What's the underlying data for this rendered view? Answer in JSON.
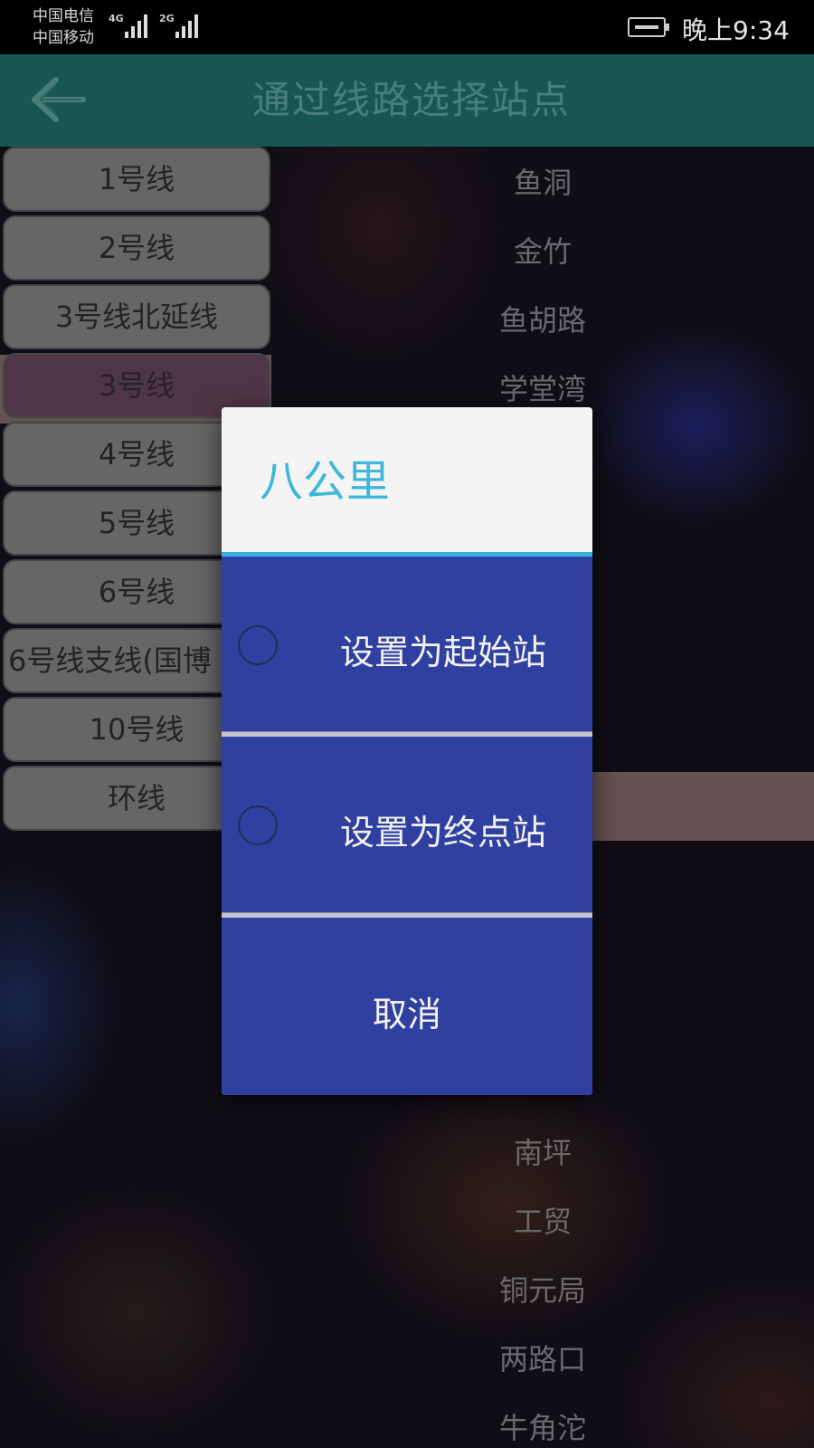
{
  "status_bar": {
    "carrier_1": "中国电信",
    "carrier_2": "中国移动",
    "network_1": "4G",
    "network_2": "2G",
    "time": "晚上9:34",
    "battery_icon": "battery-charging-icon"
  },
  "toolbar": {
    "title": "通过线路选择站点",
    "back_icon": "arrow-left-icon"
  },
  "lines": [
    {
      "label": "1号线"
    },
    {
      "label": "2号线"
    },
    {
      "label": "3号线北延线"
    },
    {
      "label": "3号线",
      "selected": true
    },
    {
      "label": "4号线"
    },
    {
      "label": "5号线"
    },
    {
      "label": "6号线"
    },
    {
      "label": "6号线支线(国博"
    },
    {
      "label": "10号线"
    },
    {
      "label": "环线"
    }
  ],
  "stations": {
    "top": [
      "鱼洞",
      "金竹",
      "鱼胡路",
      "学堂湾"
    ],
    "bottom": [
      "南坪",
      "工贸",
      "铜元局",
      "两路口",
      "牛角沱"
    ]
  },
  "dialog": {
    "title": "八公里",
    "option_start": "设置为起始站",
    "option_end": "设置为终点站",
    "cancel": "取消"
  },
  "colors": {
    "toolbar": "#1b5e57",
    "dialog_accent": "#35b3de",
    "dialog_option_bg": "#2f40a0"
  }
}
